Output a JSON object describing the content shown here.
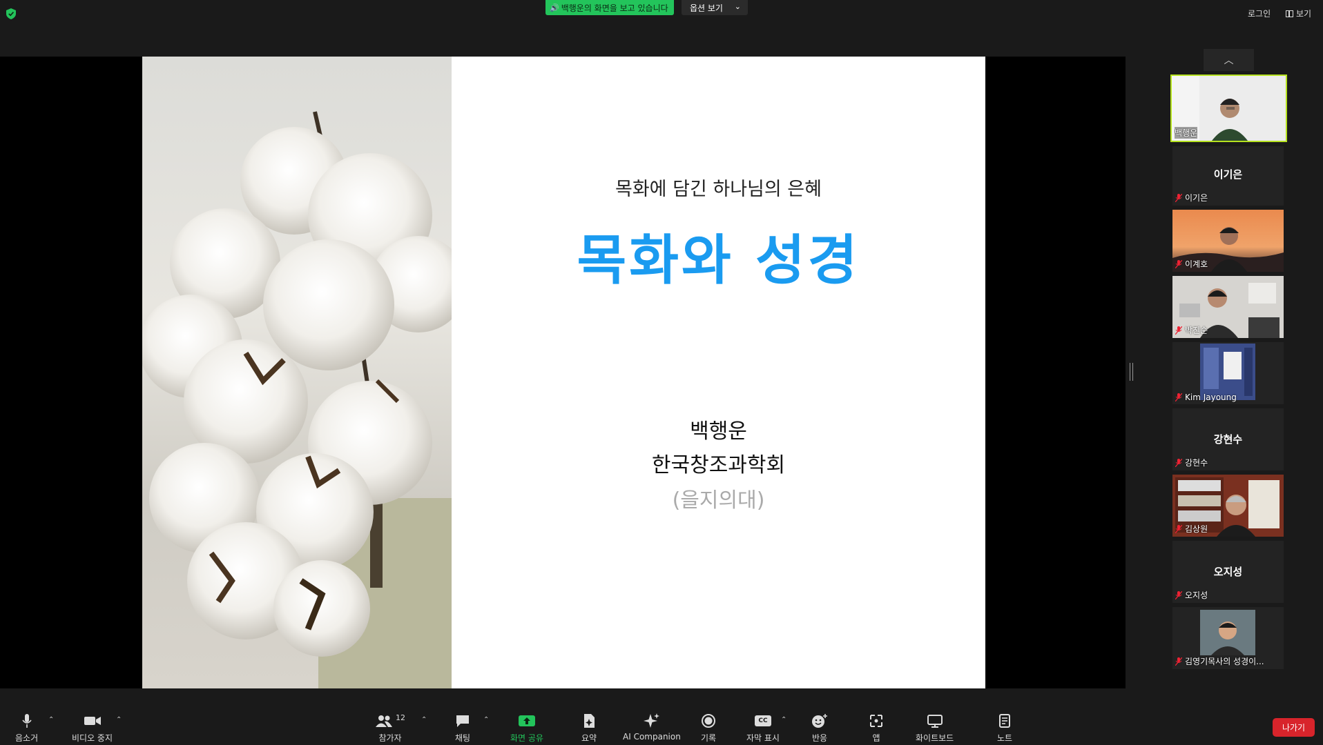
{
  "top_bar": {
    "share_banner": "백행운의 화면을 보고 있습니다",
    "view_options": "옵션 보기",
    "login": "로그인",
    "view": "보기"
  },
  "slide": {
    "subtitle": "목화에 담긴 하나님의 은혜",
    "title": "목화와 성경",
    "author": "백행운",
    "organization": "한국창조과학회",
    "university": "(을지의대)",
    "title_color": "#1a9bf0"
  },
  "participants": [
    {
      "label": "백행운",
      "video": true,
      "active": true
    },
    {
      "name": "이기은",
      "label": "이기은",
      "video": false
    },
    {
      "label": "이계호",
      "video": true
    },
    {
      "label": "박진순",
      "video": true
    },
    {
      "label": "Kim Jayoung",
      "video": true
    },
    {
      "name": "강현수",
      "label": "강현수",
      "video": false
    },
    {
      "label": "김상원",
      "video": true
    },
    {
      "name": "오지성",
      "label": "오지성",
      "video": false
    },
    {
      "label": "김영기목사의 성경이...",
      "video": true
    }
  ],
  "toolbar": {
    "mute": "음소거",
    "stop_video": "비디오 중지",
    "participants": "참가자",
    "participants_count": "12",
    "chat": "채팅",
    "share_screen": "화면 공유",
    "summary": "요약",
    "ai_companion": "AI Companion",
    "record": "기록",
    "captions": "자막 표시",
    "captions_icon_text": "CC",
    "reactions": "반응",
    "apps": "앱",
    "whiteboard": "화이트보드",
    "notes": "노트",
    "leave": "나가기"
  },
  "colors": {
    "share_green": "#23c45b",
    "leave_red": "#d8242b",
    "active_border": "#b6e31f"
  }
}
